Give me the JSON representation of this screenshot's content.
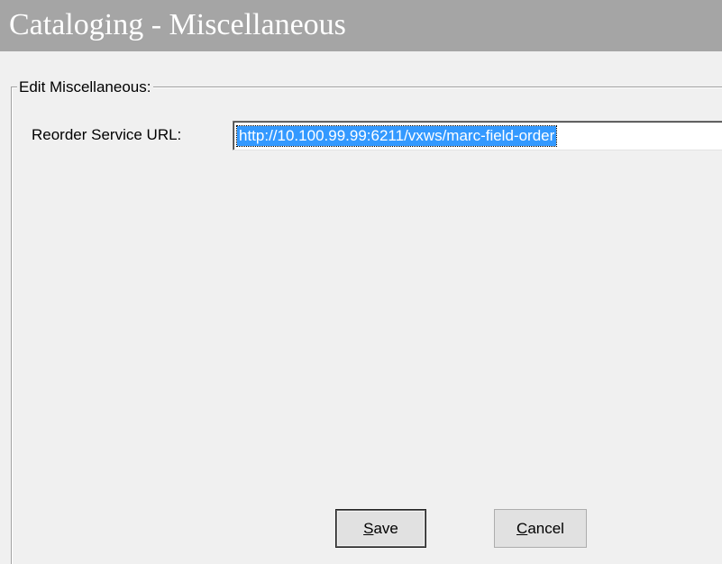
{
  "window": {
    "title": "Cataloging - Miscellaneous"
  },
  "group": {
    "title": "Edit Miscellaneous:"
  },
  "reorder_service": {
    "label": "Reorder Service URL:",
    "value": "http://10.100.99.99:6211/vxws/marc-field-order"
  },
  "buttons": {
    "save": {
      "mnemonic": "S",
      "rest": "ave"
    },
    "cancel": {
      "mnemonic": "C",
      "rest": "ancel"
    }
  },
  "colors": {
    "title_bar": "#a5a5a5",
    "dialog_background": "#f0f0f0",
    "selection_highlight": "#3399ff"
  }
}
